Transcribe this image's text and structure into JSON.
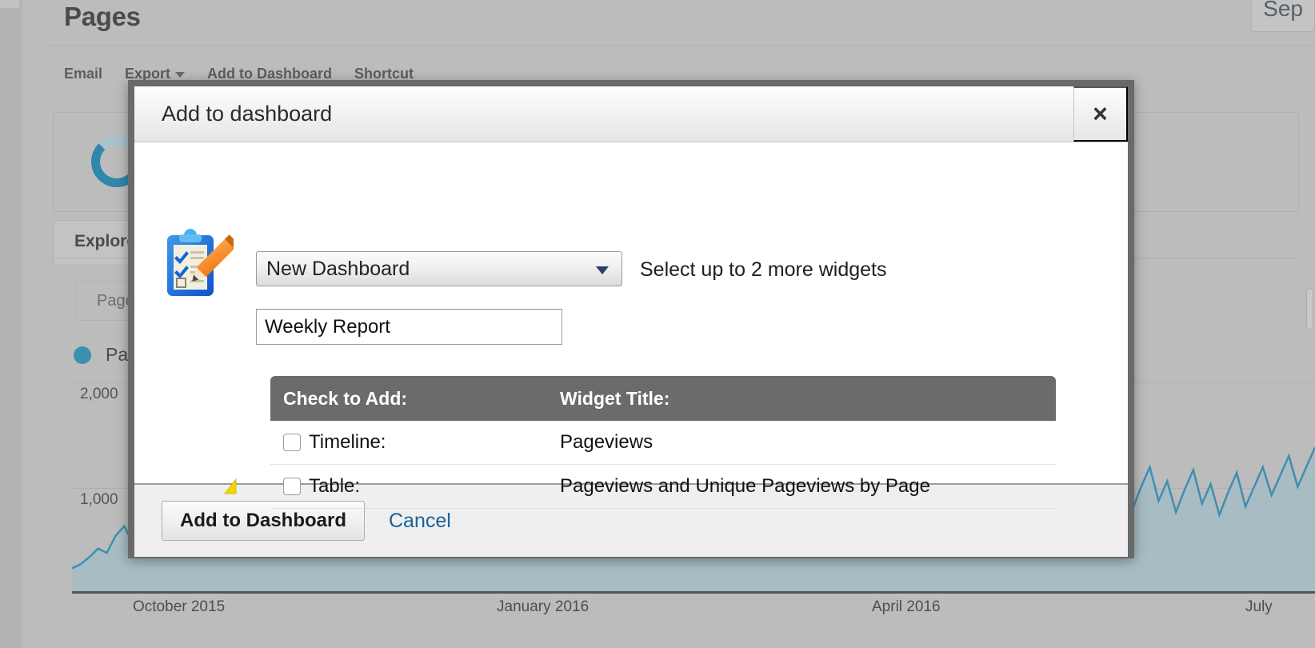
{
  "background": {
    "page_title": "Pages",
    "date_chip": "Sep",
    "actions": [
      {
        "label": "Email",
        "has_caret": false
      },
      {
        "label": "Export",
        "has_caret": true
      },
      {
        "label": "Add to Dashboard",
        "has_caret": false
      },
      {
        "label": "Shortcut",
        "has_caret": false
      }
    ],
    "tab_label": "Explorer",
    "metric_select": "Pageviews",
    "legend_label": "Pageviews",
    "y_labels": [
      "2,000",
      "1,000"
    ],
    "x_labels": [
      "October 2015",
      "January 2016",
      "April 2016",
      "July"
    ]
  },
  "chart_data": {
    "type": "area",
    "title": "Pageviews",
    "xlabel": "",
    "ylabel": "",
    "ylim": [
      0,
      2400
    ],
    "grid": true,
    "legend": [
      "Pageviews"
    ],
    "series_color": "#3d8fb0",
    "fill_color": "#a8bcc4",
    "x_tick_labels": [
      "October 2015",
      "January 2016",
      "April 2016",
      "July"
    ],
    "y_tick_labels": [
      "1,000",
      "2,000"
    ],
    "series": [
      {
        "name": "Pageviews",
        "values": [
          180,
          210,
          260,
          320,
          290,
          410,
          480,
          360,
          300,
          520,
          440,
          350,
          300,
          470,
          560,
          420,
          380,
          690,
          520,
          400,
          360,
          520,
          610,
          470,
          420,
          1420,
          980,
          620,
          520,
          470,
          640,
          560,
          480,
          900,
          740,
          560,
          480,
          620,
          820,
          600,
          520,
          740,
          900,
          660,
          560,
          700,
          840,
          620,
          540,
          660,
          780,
          600,
          520,
          640,
          760,
          580,
          500,
          600,
          720,
          560,
          490,
          580,
          700,
          540,
          470,
          560,
          680,
          520,
          460,
          540,
          660,
          510,
          450,
          530,
          640,
          500,
          440,
          520,
          620,
          490,
          430,
          510,
          610,
          480,
          420,
          500,
          600,
          470,
          410,
          490,
          590,
          460,
          400,
          480,
          580,
          450,
          390,
          470,
          900,
          1100,
          820,
          960,
          700,
          880,
          1020,
          760,
          900,
          680,
          840,
          980,
          720,
          860,
          640,
          800,
          940,
          700,
          840,
          620,
          780,
          920,
          680,
          820,
          600,
          760,
          900,
          660,
          800,
          580,
          740,
          880,
          640,
          780,
          560,
          720,
          860,
          620,
          760,
          900,
          700,
          840,
          980,
          760,
          900,
          1040
        ]
      }
    ]
  },
  "dialog": {
    "title": "Add to dashboard",
    "close_label": "×",
    "dashboard_select": {
      "value": "New Dashboard",
      "options": [
        "New Dashboard"
      ]
    },
    "widget_hint": "Select up to 2 more widgets",
    "name_input": {
      "value": "Weekly Report",
      "placeholder": ""
    },
    "table": {
      "headers": [
        "Check to Add:",
        "Widget Title:"
      ],
      "rows": [
        {
          "type_label": "Timeline:",
          "widget_title": "Pageviews",
          "checked": false,
          "warn": false
        },
        {
          "type_label": "Table:",
          "widget_title": "Pageviews and Unique Pageviews by Page",
          "checked": false,
          "warn": true
        }
      ]
    },
    "footer": {
      "submit_label": "Add to Dashboard",
      "cancel_label": "Cancel"
    }
  }
}
